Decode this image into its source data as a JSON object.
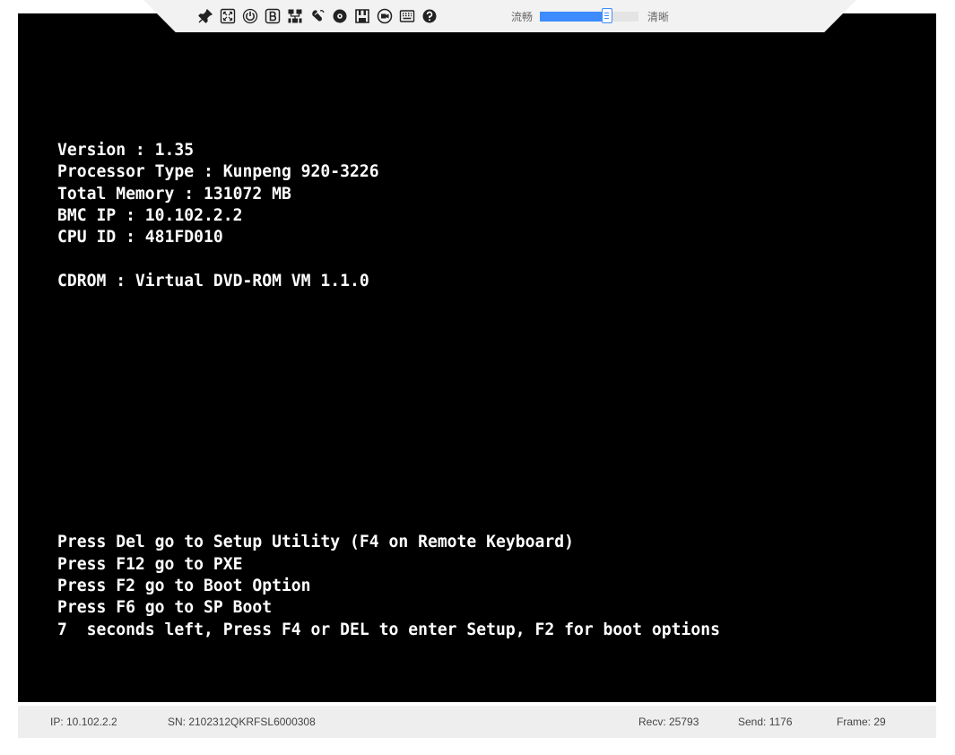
{
  "toolbar": {
    "icons": [
      "pin-icon",
      "fit-screen-icon",
      "power-icon",
      "boot-option-icon",
      "network-icon",
      "mouse-icon",
      "cd-drive-icon",
      "save-icon",
      "record-icon",
      "keyboard-icon",
      "help-icon"
    ],
    "quality_left_label": "流畅",
    "quality_right_label": "清晰",
    "quality_level": 0.68,
    "accent_color": "#3d8bfd"
  },
  "screen": {
    "lines": [
      "Version : 1.35",
      "Processor Type : Kunpeng 920-3226",
      "Total Memory : 131072 MB",
      "BMC IP : 10.102.2.2",
      "CPU ID : 481FD010",
      "",
      "CDROM : Virtual DVD-ROM VM 1.1.0",
      "",
      "",
      "",
      "",
      "",
      "",
      "",
      "",
      "",
      "",
      "",
      "Press Del go to Setup Utility (F4 on Remote Keyboard)",
      "Press F12 go to PXE",
      "Press F2 go to Boot Option",
      "Press F6 go to SP Boot",
      "7  seconds left, Press F4 or DEL to enter Setup, F2 for boot options"
    ]
  },
  "status": {
    "ip": "IP: 10.102.2.2",
    "sn": "SN: 2102312QKRFSL6000308",
    "recv": "Recv: 25793",
    "send": "Send: 1176",
    "frame": "Frame: 29"
  }
}
